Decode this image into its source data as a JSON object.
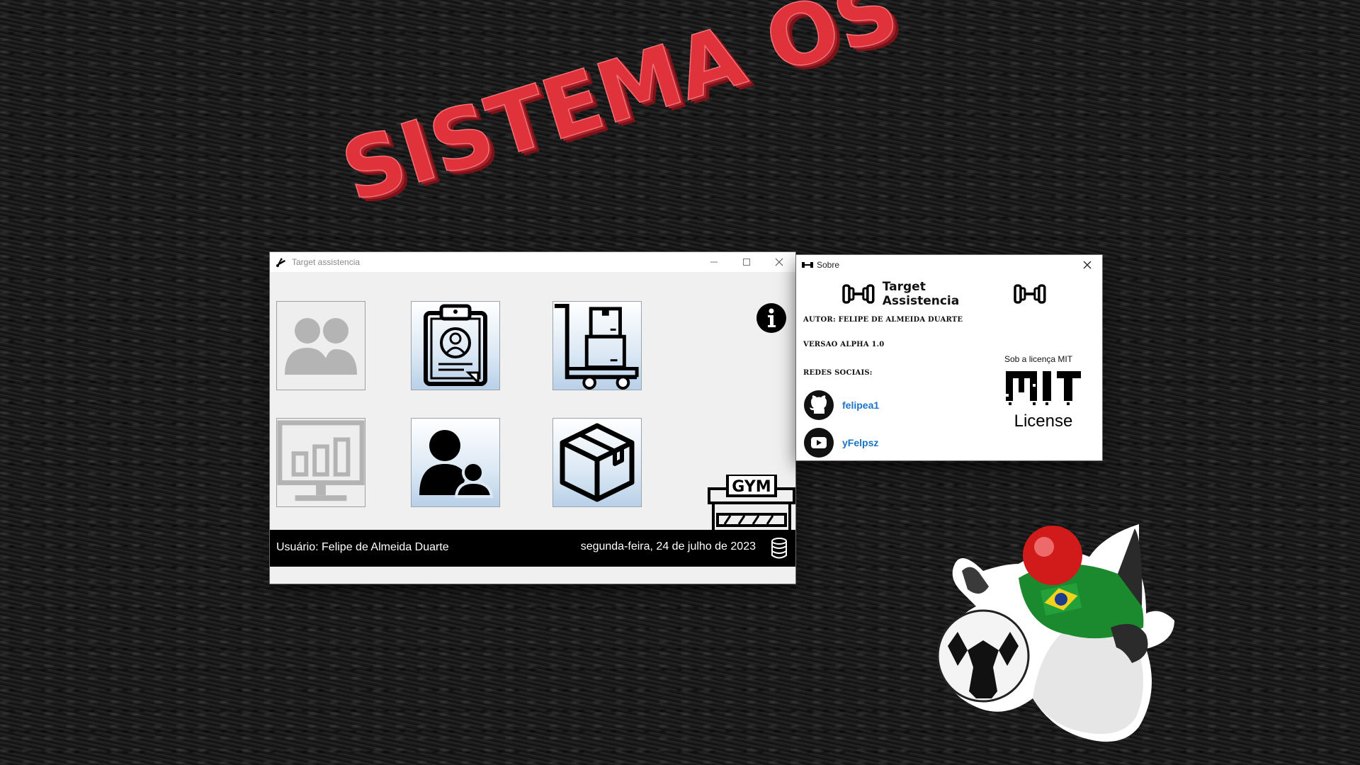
{
  "background": {
    "headline": "SISTEMA OS",
    "headline_color": "#e0323a"
  },
  "main_window": {
    "title": "Target assistencia",
    "controls": {
      "minimize": "minimize-icon",
      "maximize": "maximize-icon",
      "close": "close-icon"
    },
    "tiles": [
      {
        "name": "clients-tile",
        "icon": "users-icon",
        "enabled": false
      },
      {
        "name": "employee-tile",
        "icon": "id-badge-clipboard-icon",
        "enabled": true
      },
      {
        "name": "inventory-tile",
        "icon": "hand-truck-boxes-icon",
        "enabled": true
      },
      {
        "name": "reports-tile",
        "icon": "monitor-bar-chart-icon",
        "enabled": false
      },
      {
        "name": "users-tile",
        "icon": "user-group-icon",
        "enabled": true
      },
      {
        "name": "products-tile",
        "icon": "package-icon",
        "enabled": true
      }
    ],
    "info_button": "info-icon",
    "gym_sign": "GYM",
    "status": {
      "user": "Usuário: Felipe de Almeida Duarte",
      "date": "segunda-feira, 24 de julho de 2023",
      "db_icon": "database-icon"
    }
  },
  "about_window": {
    "title": "Sobre",
    "app_name": "Target Assistencia",
    "author": "AUTOR: FELIPE DE ALMEIDA DUARTE",
    "version": "VERSAO ALPHA 1.0",
    "social_heading": "REDES SOCIAIS:",
    "social": [
      {
        "icon": "github-icon",
        "handle": "felipea1"
      },
      {
        "icon": "youtube-icon",
        "handle": "yFelpsz"
      }
    ],
    "license_label": "Sob a licença MIT",
    "mit_text": "MIT",
    "mit_sub": "License",
    "accent": "#1a73c8"
  }
}
